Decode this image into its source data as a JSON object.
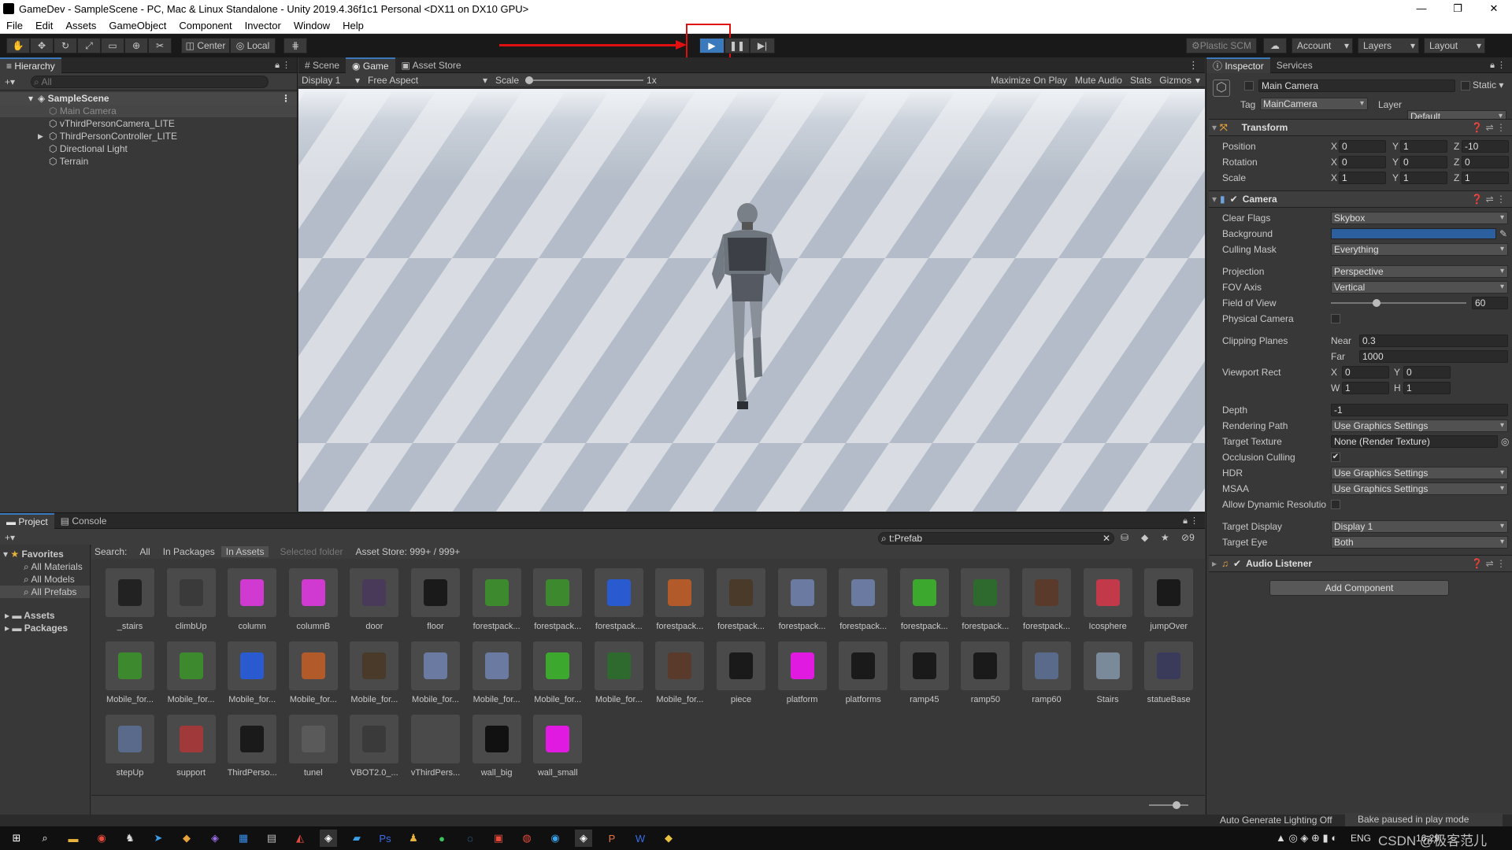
{
  "window": {
    "title": "GameDev - SampleScene - PC, Mac & Linux Standalone - Unity 2019.4.36f1c1 Personal <DX11 on DX10 GPU>",
    "min": "—",
    "max": "❐",
    "close": "✕"
  },
  "menu": [
    "File",
    "Edit",
    "Assets",
    "GameObject",
    "Component",
    "Invector",
    "Window",
    "Help"
  ],
  "toolbar": {
    "center": "Center",
    "local": "Local",
    "plastic": "Plastic SCM",
    "account": "Account",
    "layers": "Layers",
    "layout": "Layout"
  },
  "hierarchy": {
    "tab": "Hierarchy",
    "search_placeholder": "All",
    "scene": "SampleScene",
    "items": [
      "Main Camera",
      "vThirdPersonCamera_LITE",
      "ThirdPersonController_LITE",
      "Directional Light",
      "Terrain"
    ]
  },
  "game": {
    "tabs": [
      "Scene",
      "Game",
      "Asset Store"
    ],
    "display": "Display 1",
    "aspect": "Free Aspect",
    "scale_label": "Scale",
    "scale_value": "1x",
    "options": [
      "Maximize On Play",
      "Mute Audio",
      "Stats",
      "Gizmos"
    ]
  },
  "inspector": {
    "tabs": [
      "Inspector",
      "Services"
    ],
    "object_name": "Main Camera",
    "static": "Static",
    "tag_label": "Tag",
    "tag": "MainCamera",
    "layer_label": "Layer",
    "layer": "Default",
    "transform": {
      "title": "Transform",
      "position": {
        "label": "Position",
        "x": "0",
        "y": "1",
        "z": "-10"
      },
      "rotation": {
        "label": "Rotation",
        "x": "0",
        "y": "0",
        "z": "0"
      },
      "scale": {
        "label": "Scale",
        "x": "1",
        "y": "1",
        "z": "1"
      }
    },
    "camera": {
      "title": "Camera",
      "clear_flags": {
        "label": "Clear Flags",
        "value": "Skybox"
      },
      "background": {
        "label": "Background",
        "color": "#2b5f9e"
      },
      "culling_mask": {
        "label": "Culling Mask",
        "value": "Everything"
      },
      "projection": {
        "label": "Projection",
        "value": "Perspective"
      },
      "fov_axis": {
        "label": "FOV Axis",
        "value": "Vertical"
      },
      "fov": {
        "label": "Field of View",
        "value": "60",
        "fraction": 0.33
      },
      "physical_camera": "Physical Camera",
      "clipping": {
        "label": "Clipping Planes",
        "near_label": "Near",
        "near": "0.3",
        "far_label": "Far",
        "far": "1000"
      },
      "viewport": {
        "label": "Viewport Rect",
        "x": "0",
        "y": "0",
        "w": "1",
        "h": "1"
      },
      "depth": {
        "label": "Depth",
        "value": "-1"
      },
      "rendering_path": {
        "label": "Rendering Path",
        "value": "Use Graphics Settings"
      },
      "target_texture": {
        "label": "Target Texture",
        "value": "None (Render Texture)"
      },
      "occlusion": {
        "label": "Occlusion Culling",
        "checked": true
      },
      "hdr": {
        "label": "HDR",
        "value": "Use Graphics Settings"
      },
      "msaa": {
        "label": "MSAA",
        "value": "Use Graphics Settings"
      },
      "dynamic_res": "Allow Dynamic Resolutio",
      "target_display": {
        "label": "Target Display",
        "value": "Display 1"
      },
      "target_eye": {
        "label": "Target Eye",
        "value": "Both"
      }
    },
    "audio_listener": "Audio Listener",
    "add_component": "Add Component"
  },
  "project": {
    "tabs": [
      "Project",
      "Console"
    ],
    "search": "t:Prefab",
    "filter_label": "Search:",
    "filters": [
      "All",
      "In Packages",
      "In Assets",
      "Selected folder",
      "Asset Store: 999+ / 999+"
    ],
    "hidden_count": "9",
    "favorites": {
      "title": "Favorites",
      "items": [
        "All Materials",
        "All Models",
        "All Prefabs"
      ]
    },
    "folders": [
      "Assets",
      "Packages"
    ],
    "assets": [
      "_stairs",
      "climbUp",
      "column",
      "columnB",
      "door",
      "floor",
      "forestpack...",
      "forestpack...",
      "forestpack...",
      "forestpack...",
      "forestpack...",
      "forestpack...",
      "forestpack...",
      "forestpack...",
      "forestpack...",
      "forestpack...",
      "Icosphere",
      "jumpOver",
      "Mobile_for...",
      "Mobile_for...",
      "Mobile_for...",
      "Mobile_for...",
      "Mobile_for...",
      "Mobile_for...",
      "Mobile_for...",
      "Mobile_for...",
      "Mobile_for...",
      "Mobile_for...",
      "piece",
      "platform",
      "platforms",
      "ramp45",
      "ramp50",
      "ramp60",
      "Stairs",
      "statueBase",
      "stepUp",
      "support",
      "ThirdPerso...",
      "tunel",
      "VBOT2.0_...",
      "vThirdPers...",
      "wall_big",
      "wall_small"
    ]
  },
  "status": {
    "lighting": "Auto Generate Lighting Off",
    "bake": "Bake paused in play mode"
  },
  "taskbar": {
    "lang": "ENG",
    "time": "16:29",
    "watermark": "CSDN @极客范儿"
  }
}
